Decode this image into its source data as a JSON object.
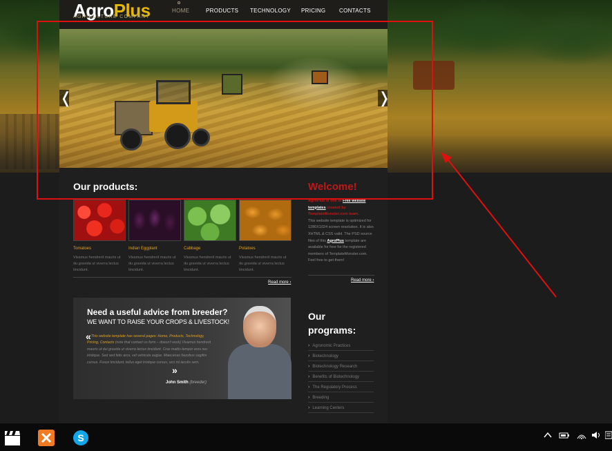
{
  "site": {
    "logo_main": "Agro",
    "logo_plus": "Plus",
    "tagline": "AGRICULTURE COMPANY"
  },
  "nav": {
    "home": "HOME",
    "products": "PRODUCTS",
    "technology": "TECHNOLOGY",
    "pricing": "PRICING",
    "contacts": "CONTACTS"
  },
  "slider": {
    "prev_glyph": "❬",
    "next_glyph": "❭"
  },
  "products": {
    "title": "Our products:",
    "items": [
      {
        "name": "Tomatoes",
        "desc": "Vivamus hendrerit mauris ut du gravida ut viverra lectus tincidunt."
      },
      {
        "name": "Indian Eggplant",
        "desc": "Vivamus hendrerit mauris ut du gravida ut viverra lectus tincidunt."
      },
      {
        "name": "Cabbage",
        "desc": "Vivamus hendrerit mauris ut du gravida ut viverra lectus tincidunt."
      },
      {
        "name": "Potatoes",
        "desc": "Vivamus hendrerit mauris ut du gravida ut viverra lectus tincidunt."
      }
    ],
    "read_more": "Read more"
  },
  "welcome": {
    "title": "Welcome!",
    "lead_1": "AgroPlus is one of ",
    "lead_link": "Free website templates",
    "lead_2": " created by TemplateMonster.com team.",
    "body_1": "This website template is optimized for 1280X1024 screen resolution. It is also XHTML & CSS valid. The PSD source files of this ",
    "body_brand": "AgroPlus",
    "body_2": " template are available for free for the registered members of TemplateMonster.com. Feel free to get them!",
    "read_more": "Read more"
  },
  "advice": {
    "heading": "Need a useful advice from breeder?",
    "subheading": "WE WANT TO RAISE YOUR CROPS & LIVESTOCK!",
    "open_quote": "«",
    "close_quote": "»",
    "text_highlight": "This website template has several pages: Home, Products, Technology, Pricing, Contacts",
    "text_rest": " (note that contact us form – doesn't work) Vivamus hendrerit mauris ut dui gravida ut viverra lectus tincidunt. Cras mattis tempor eros nec tristique. Sed sed felis arcu, vel vehicula augue. Maecenas faucibus sagittis cursus. Fusce tincidunt, tellus eget tristique cursus, orci mi iaculis sem.",
    "author_name": "John Smith",
    "author_role": "(breeder)"
  },
  "programs": {
    "title_1": "Our",
    "title_2": "programs:",
    "items": [
      "Agronomic Practices",
      "Biotechnology",
      "Biotechnology Research",
      "Benefits of Biotechnology",
      "The Regulatory Process",
      "Breeding",
      "Learning Centers"
    ]
  },
  "icons": {
    "program_arrow": "›",
    "readmore_arrow": "›"
  },
  "colors": {
    "accent_gold": "#e6b800",
    "welcome_red": "#c01818",
    "annotation_red": "#e01010",
    "product_name": "#e0a020"
  }
}
